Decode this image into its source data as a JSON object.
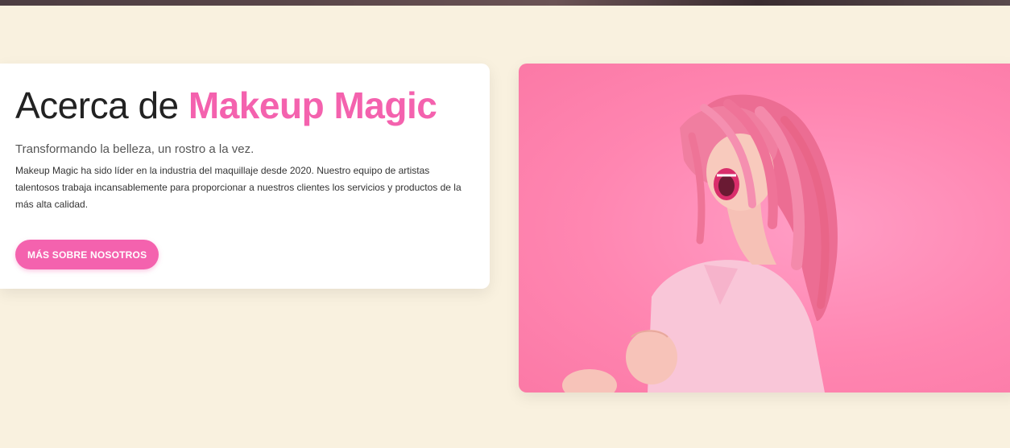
{
  "about": {
    "title_prefix": "Acerca de",
    "title_brand": "Makeup Magic",
    "subtitle": "Transformando la belleza, un rostro a la vez.",
    "body": "Makeup Magic ha sido líder en la industria del maquillaje desde 2020. Nuestro equipo de artistas talentosos trabaja incansablemente para proporcionar a nuestros clientes los servicios y productos de la más alta calidad.",
    "button_label": "MÁS SOBRE NOSOTROS"
  },
  "colors": {
    "page_background": "#f9f1df",
    "accent_pink": "#f462ae",
    "card_background": "#ffffff",
    "image_background": "#ff86b1"
  }
}
